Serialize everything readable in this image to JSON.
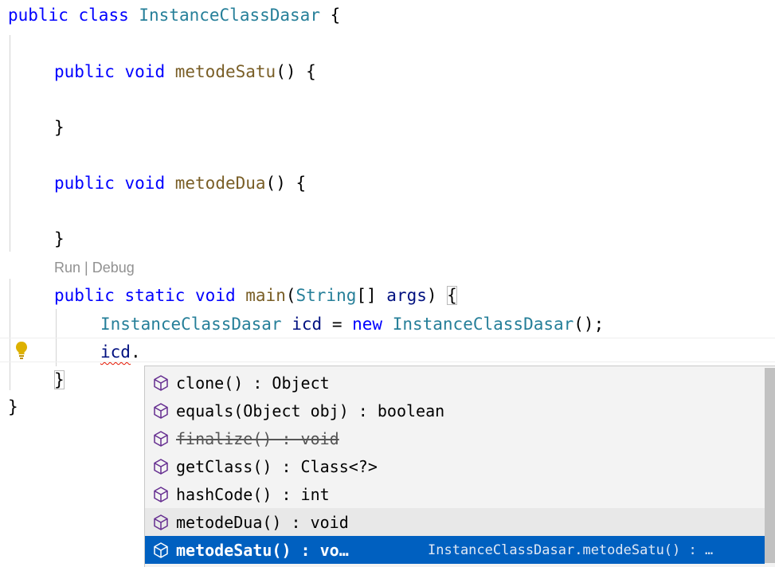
{
  "editor": {
    "line1": {
      "kw": "public",
      "kw2": "class",
      "name": "InstanceClassDasar",
      "brace": "{"
    },
    "line2": {
      "kw": "public",
      "type": "void",
      "fn": "metodeSatu",
      "rest": "() {"
    },
    "line3": {
      "text": "}"
    },
    "line4": {
      "kw": "public",
      "type": "void",
      "fn": "metodeDua",
      "rest": "() {"
    },
    "line5": {
      "text": "}"
    },
    "codelens": "Run | Debug",
    "line6": {
      "kw": "public",
      "kw2": "static",
      "kw3": "void",
      "fn": "main",
      "p1": "(",
      "type": "String",
      "p2": "[] ",
      "var": "args",
      "p3": ") ",
      "brace": "{"
    },
    "line7": {
      "type": "InstanceClassDasar",
      "var": "icd",
      "eq": " = ",
      "kw": "new",
      "type2": "InstanceClassDasar",
      "rest": "();"
    },
    "line8": {
      "var": "icd",
      "dot": "."
    },
    "line9": {
      "text": "}"
    },
    "line10": {
      "text": "}"
    }
  },
  "suggest": {
    "items": [
      {
        "label": "clone() : Object",
        "icon": "method-cube-icon"
      },
      {
        "label": "equals(Object obj) : boolean",
        "icon": "method-cube-icon"
      },
      {
        "label": "finalize() : void",
        "icon": "method-cube-icon",
        "deprecated": true
      },
      {
        "label": "getClass() : Class<?>",
        "icon": "method-cube-icon"
      },
      {
        "label": "hashCode() : int",
        "icon": "method-cube-icon"
      },
      {
        "label": "metodeDua() : void",
        "icon": "method-cube-icon"
      },
      {
        "label": "metodeSatu() : vo…",
        "detail": "InstanceClassDasar.metodeSatu() : …",
        "icon": "method-cube-icon",
        "selected": true
      }
    ]
  },
  "colors": {
    "keyword": "#0000ff",
    "type": "#267f99",
    "function": "#795e26",
    "variable": "#001080",
    "selection": "#0060c0",
    "error": "#e51400"
  }
}
